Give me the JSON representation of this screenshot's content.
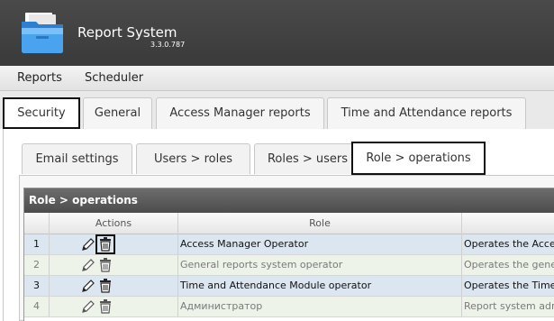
{
  "app": {
    "title": "Report System",
    "version": "3.3.0.787"
  },
  "menu": [
    "Reports",
    "Scheduler"
  ],
  "tabs": [
    "Security",
    "General",
    "Access Manager reports",
    "Time and Attendance reports"
  ],
  "subtabs": [
    "Email settings",
    "Users > roles",
    "Roles > users",
    "Role > operations"
  ],
  "grid": {
    "title": "Role > operations",
    "headers": {
      "actions": "Actions",
      "role": "Role",
      "description": ""
    },
    "rows": [
      {
        "num": "1",
        "role": "Access Manager Operator",
        "description": "Operates the Access M"
      },
      {
        "num": "2",
        "role": "General reports system operator",
        "description": "Operates the general r"
      },
      {
        "num": "3",
        "role": "Time and Attendance Module operator",
        "description": "Operates the Time and"
      },
      {
        "num": "4",
        "role": "Администратор",
        "description": "Report system adminis"
      }
    ]
  },
  "icons": {
    "edit": "pencil-icon",
    "delete": "trash-icon"
  }
}
